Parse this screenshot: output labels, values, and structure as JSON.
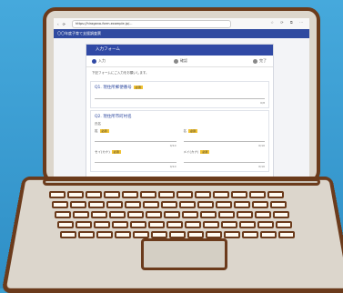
{
  "browser": {
    "url": "https://hiragana-form.example.jp/...",
    "tool_icons": "☆ ⟳ ⧉ ⋯"
  },
  "site": {
    "header_title": "〇〇年度子育て支援調査票"
  },
  "form": {
    "title": "入力フォーム",
    "steps": [
      {
        "label": "入力",
        "active": true
      },
      {
        "label": "確認",
        "active": false
      },
      {
        "label": "完了",
        "active": false
      }
    ],
    "note": "下記フォームにご入力をお願いします。",
    "q1": {
      "title": "Q1. 現住所郵便番号",
      "required": "必須",
      "counter": "0/8"
    },
    "q2": {
      "title": "Q2. 現住所市町村名",
      "name_label": "氏名",
      "fields": [
        {
          "label": "姓",
          "required": "必須",
          "counter": "0/10"
        },
        {
          "label": "名",
          "required": "必須",
          "counter": "0/10"
        },
        {
          "label": "セイ(カナ)",
          "required": "必須",
          "counter": "0/10"
        },
        {
          "label": "メイ(カナ)",
          "required": "必須",
          "counter": "0/10"
        }
      ]
    }
  }
}
